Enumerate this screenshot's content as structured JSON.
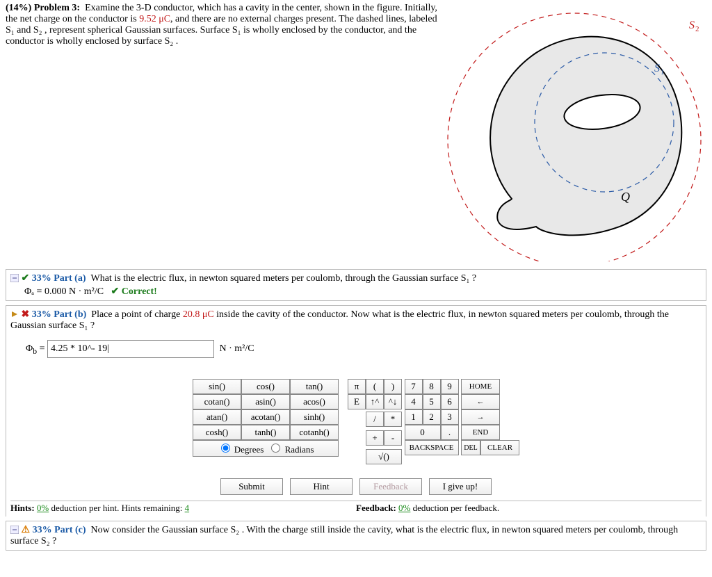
{
  "problem": {
    "header": "(14%) Problem 3:",
    "text_before_charge": "Examine the 3-D conductor, which has a cavity in the center, shown in the figure. Initially, the net charge on the conductor is ",
    "charge_value": "9.52 μC",
    "text_after_charge": ", and there are no external charges present. The dashed lines, labeled S₁ and S₂ , represent spherical Gaussian surfaces. Surface S₁ is wholly enclosed by the conductor, and the conductor is wholly enclosed by surface S₂ ."
  },
  "figure": {
    "s1_label": "S₁",
    "s2_label": "S₂",
    "q_label": "Q"
  },
  "part_a": {
    "percent": "33% Part (a)",
    "question": "What is the electric flux, in newton squared meters per coulomb, through the Gaussian surface S₁ ?",
    "answer_label": "Φₐ = 0.000 N · m²/C",
    "correct_label": "✔ Correct!"
  },
  "part_b": {
    "percent": "33% Part (b)",
    "q_pre": "Place a point of charge ",
    "q_charge": "20.8 μC",
    "q_post": " inside the cavity of the conductor. Now what is the electric flux, in newton squared meters per coulomb, through the Gaussian surface S₁ ?",
    "phi_label": "Φ_b =",
    "input_value": "4.25 * 10^- 19|",
    "unit": "N · m²/C"
  },
  "keypad": {
    "funcs": [
      [
        "sin()",
        "cos()",
        "tan()"
      ],
      [
        "cotan()",
        "asin()",
        "acos()"
      ],
      [
        "atan()",
        "acotan()",
        "sinh()"
      ],
      [
        "cosh()",
        "tanh()",
        "cotanh()"
      ]
    ],
    "mode_degrees": "Degrees",
    "mode_radians": "Radians",
    "ops": [
      [
        "π",
        "(",
        ")"
      ],
      [
        "E",
        "↑^",
        "^↓"
      ],
      [
        "",
        "/",
        "*"
      ],
      [
        "",
        "+",
        "-"
      ]
    ],
    "nums": [
      [
        "7",
        "8",
        "9"
      ],
      [
        "4",
        "5",
        "6"
      ],
      [
        "1",
        "2",
        "3"
      ]
    ],
    "zero": "0",
    "dot": ".",
    "sqrt": "√()",
    "home": "HOME",
    "left": "←",
    "right": "→",
    "end": "END",
    "backspace": "BACKSPACE",
    "del": "DEL",
    "clear": "CLEAR"
  },
  "buttons": {
    "submit": "Submit",
    "hint": "Hint",
    "feedback": "Feedback",
    "giveup": "I give up!"
  },
  "hints": {
    "hint_prefix": "Hints: ",
    "hint_pct": "0%",
    "hint_text": " deduction per hint. Hints remaining: ",
    "hint_remaining": "4",
    "fb_prefix": "Feedback: ",
    "fb_pct": "0%",
    "fb_text": " deduction per feedback."
  },
  "part_c": {
    "percent": "33% Part (c)",
    "question": "Now consider the Gaussian surface S₂ . With the charge still inside the cavity, what is the electric flux, in newton squared meters per coulomb, through surface S₂ ?"
  }
}
